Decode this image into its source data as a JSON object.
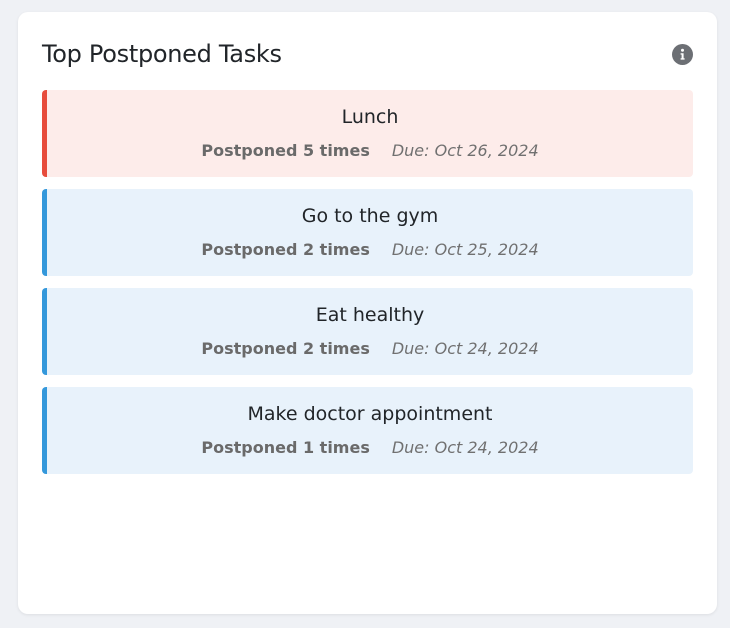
{
  "widget": {
    "title": "Top Postponed Tasks",
    "info_icon": "info-circle-icon"
  },
  "colors": {
    "high_accent": "#e74c3c",
    "high_bg": "#fdecea",
    "normal_accent": "#3498db",
    "normal_bg": "#e8f2fb"
  },
  "tasks": [
    {
      "name": "Lunch",
      "postponed": "Postponed 5 times",
      "due": "Due: Oct 26, 2024",
      "priority": "high"
    },
    {
      "name": "Go to the gym",
      "postponed": "Postponed 2 times",
      "due": "Due: Oct 25, 2024",
      "priority": "normal"
    },
    {
      "name": "Eat healthy",
      "postponed": "Postponed 2 times",
      "due": "Due: Oct 24, 2024",
      "priority": "normal"
    },
    {
      "name": "Make doctor appointment",
      "postponed": "Postponed 1 times",
      "due": "Due: Oct 24, 2024",
      "priority": "normal"
    }
  ]
}
